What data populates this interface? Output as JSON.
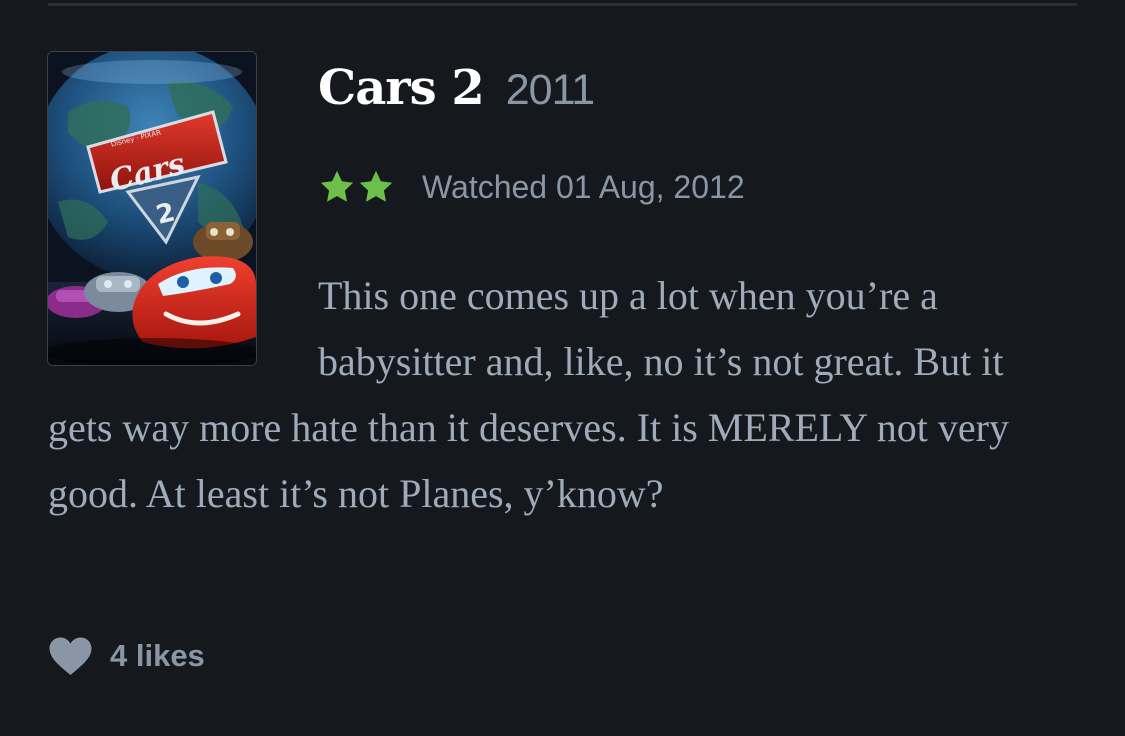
{
  "film": {
    "title": "Cars 2",
    "year": "2011",
    "poster_wordmark": "Cars",
    "poster_number": "2",
    "poster_studio": "Disney · PIXAR"
  },
  "rating": {
    "stars": 2,
    "star_color": "#6cc04a"
  },
  "watched_label": "Watched 01 Aug, 2012",
  "review_text": "This one comes up a lot when you’re a babysitter and, like, no it’s not great. But it gets way more hate than it deserves. It is MERELY not very good. At least it’s not Planes, y’know?",
  "likes": {
    "icon": "heart-icon",
    "label": "4 likes"
  },
  "colors": {
    "background": "#15181d",
    "title": "#ffffff",
    "muted": "#8a96a6",
    "body_text": "#9fabbb"
  }
}
